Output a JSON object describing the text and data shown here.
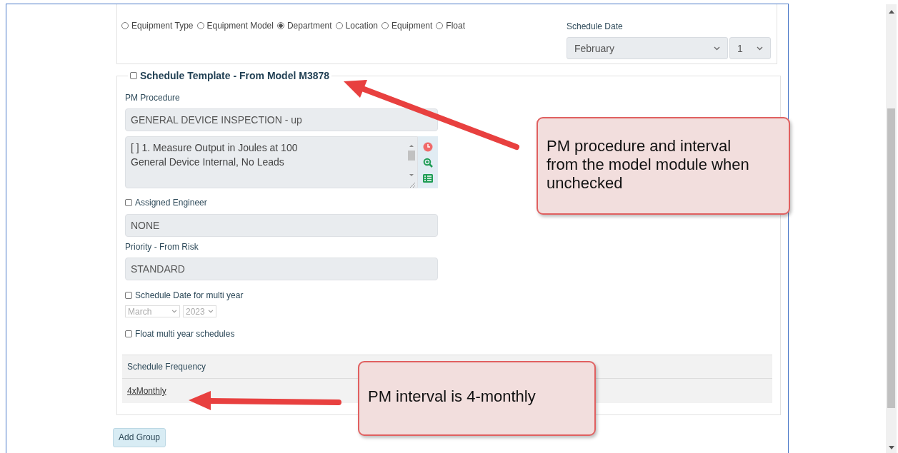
{
  "radio_options": [
    {
      "label": "Equipment Type",
      "selected": false
    },
    {
      "label": "Equipment Model",
      "selected": false
    },
    {
      "label": "Department",
      "selected": true
    },
    {
      "label": "Location",
      "selected": false
    },
    {
      "label": "Equipment",
      "selected": false
    },
    {
      "label": "Float",
      "selected": false
    }
  ],
  "schedule_date": {
    "label": "Schedule Date",
    "month": "February",
    "day": "1"
  },
  "template": {
    "label": "Schedule Template - From Model M3878",
    "checked": false
  },
  "pm_procedure": {
    "label": "PM Procedure",
    "value": "GENERAL DEVICE INSPECTION - up",
    "steps": [
      "[ ] 1. Measure Output in Joules at 100",
      "General Device Internal, No Leads"
    ]
  },
  "assigned_engineer": {
    "label": "Assigned Engineer",
    "checked": false,
    "value": "NONE"
  },
  "priority": {
    "label": "Priority - From Risk",
    "value": "STANDARD"
  },
  "multi_year": {
    "label": "Schedule Date for multi year",
    "checked": false,
    "month": "March",
    "year": "2023"
  },
  "float_multi_year": {
    "label": "Float multi year schedules",
    "checked": false
  },
  "frequency_table": {
    "column": "Schedule Frequency",
    "rows": [
      "4xMonthly"
    ]
  },
  "add_group_button": "Add Group",
  "callouts": [
    {
      "text": "PM procedure and interval from the model module when unchecked"
    },
    {
      "text": "PM interval is 4-monthly"
    }
  ]
}
